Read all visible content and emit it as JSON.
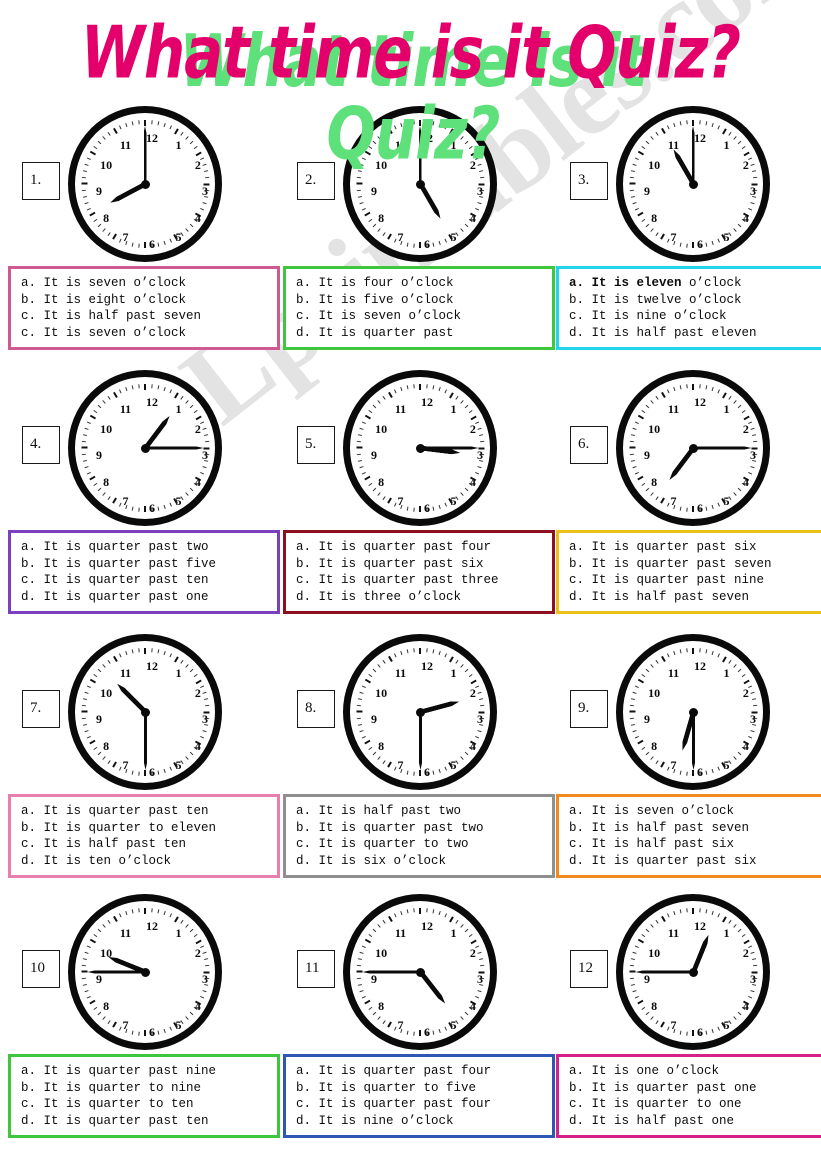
{
  "title": {
    "text": "What time is it Quiz?",
    "color": "#e4006b",
    "shadow_color": "#5ee07a"
  },
  "watermark": {
    "text": "ESLprintables.com"
  },
  "clock_numerals": [
    "12",
    "1",
    "2",
    "3",
    "4",
    "5",
    "6",
    "7",
    "8",
    "9",
    "10",
    "11"
  ],
  "questions": [
    {
      "number": "1.",
      "border_color": "#cf5a92",
      "clock": {
        "reads": "8:00",
        "hour_deg": 242,
        "minute_deg": 0
      },
      "options": [
        {
          "text": "a. It is seven o’clock",
          "bold": false
        },
        {
          "text": "b. It is eight o’clock",
          "bold": false
        },
        {
          "text": "c. It is half past seven",
          "bold": false
        },
        {
          "text": "c. It is seven o’clock",
          "bold": false
        }
      ]
    },
    {
      "number": "2.",
      "border_color": "#3ec73e",
      "clock": {
        "reads": "5:00",
        "hour_deg": 150,
        "minute_deg": 0
      },
      "options": [
        {
          "text": "a. It is four o’clock",
          "bold": false
        },
        {
          "text": "b. It is five o’clock",
          "bold": false
        },
        {
          "text": "c. It is seven o’clock",
          "bold": false
        },
        {
          "text": "d. It is quarter past",
          "bold": false
        }
      ]
    },
    {
      "number": "3.",
      "border_color": "#22d3ee",
      "clock": {
        "reads": "11:00",
        "hour_deg": 330,
        "minute_deg": 0
      },
      "options": [
        {
          "text": "a. It is eleven o’clock",
          "bold": true,
          "bold_part": "a. It is eleven",
          "rest": " o’clock"
        },
        {
          "text": "b. It is twelve o’clock",
          "bold": false
        },
        {
          "text": "c. It is nine o’clock",
          "bold": false
        },
        {
          "text": "d. It is half past eleven",
          "bold": false
        }
      ]
    },
    {
      "number": "4.",
      "border_color": "#7b3fbf",
      "clock": {
        "reads": "1:15",
        "hour_deg": 37,
        "minute_deg": 90
      },
      "options": [
        {
          "text": "a. It is quarter past two",
          "bold": false
        },
        {
          "text": "b. It is quarter past five",
          "bold": false
        },
        {
          "text": "c. It is quarter past ten",
          "bold": false
        },
        {
          "text": "d. It is quarter past one",
          "bold": false
        }
      ]
    },
    {
      "number": "5.",
      "border_color": "#8c1020",
      "clock": {
        "reads": "3:15",
        "hour_deg": 97,
        "minute_deg": 90
      },
      "options": [
        {
          "text": "a. It is quarter past four",
          "bold": false
        },
        {
          "text": "b. It is quarter past six",
          "bold": false
        },
        {
          "text": "c. It is quarter past three",
          "bold": false
        },
        {
          "text": "d. It is three o’clock",
          "bold": false
        }
      ]
    },
    {
      "number": "6.",
      "border_color": "#e8c21a",
      "clock": {
        "reads": "7:15",
        "hour_deg": 217,
        "minute_deg": 90
      },
      "options": [
        {
          "text": "a. It is quarter past six",
          "bold": false
        },
        {
          "text": "b. It is quarter past seven",
          "bold": false
        },
        {
          "text": "c. It is quarter past nine",
          "bold": false
        },
        {
          "text": "d. It is half past seven",
          "bold": false
        }
      ]
    },
    {
      "number": "7.",
      "border_color": "#e87fae",
      "clock": {
        "reads": "10:30",
        "hour_deg": 315,
        "minute_deg": 180
      },
      "options": [
        {
          "text": "a. It is quarter past ten",
          "bold": false
        },
        {
          "text": "b. It is quarter to eleven",
          "bold": false
        },
        {
          "text": "c. It is half past ten",
          "bold": false
        },
        {
          "text": "d. It is ten o’clock",
          "bold": false
        }
      ]
    },
    {
      "number": "8.",
      "border_color": "#8f8f8f",
      "clock": {
        "reads": "2:30",
        "hour_deg": 75,
        "minute_deg": 180
      },
      "options": [
        {
          "text": "a. It is half past two",
          "bold": false
        },
        {
          "text": "b. It is quarter past two",
          "bold": false
        },
        {
          "text": "c. It is quarter to two",
          "bold": false
        },
        {
          "text": "d. It is six o’clock",
          "bold": false
        }
      ]
    },
    {
      "number": "9.",
      "border_color": "#f08a1e",
      "clock": {
        "reads": "6:30",
        "hour_deg": 196,
        "minute_deg": 180
      },
      "options": [
        {
          "text": "a. It is seven o’clock",
          "bold": false
        },
        {
          "text": "b. It is half past seven",
          "bold": false
        },
        {
          "text": "c. It is half past six",
          "bold": false
        },
        {
          "text": "d. It is quarter past six",
          "bold": false
        }
      ]
    },
    {
      "number": "10",
      "border_color": "#3ec73e",
      "clock": {
        "reads": "9:45",
        "hour_deg": 292,
        "minute_deg": 270
      },
      "options": [
        {
          "text": "a. It is quarter past nine",
          "bold": false
        },
        {
          "text": "b. It is quarter to nine",
          "bold": false
        },
        {
          "text": "c. It is quarter to ten",
          "bold": false
        },
        {
          "text": "d. It is quarter past ten",
          "bold": false
        }
      ]
    },
    {
      "number": "11",
      "border_color": "#2f56b5",
      "clock": {
        "reads": "4:45",
        "hour_deg": 142,
        "minute_deg": 270
      },
      "options": [
        {
          "text": "a. It is quarter past four",
          "bold": false
        },
        {
          "text": "b. It is quarter to five",
          "bold": false
        },
        {
          "text": "c. It is quarter past four",
          "bold": false
        },
        {
          "text": "d. It is nine o’clock",
          "bold": false
        }
      ]
    },
    {
      "number": "12",
      "border_color": "#d6218a",
      "clock": {
        "reads": "12:45",
        "hour_deg": 22,
        "minute_deg": 270
      },
      "options": [
        {
          "text": "a. It is one o’clock",
          "bold": false
        },
        {
          "text": "b. It is quarter past one",
          "bold": false
        },
        {
          "text": "c. It is quarter to one",
          "bold": false
        },
        {
          "text": "d. It is half past one",
          "bold": false
        }
      ]
    }
  ]
}
